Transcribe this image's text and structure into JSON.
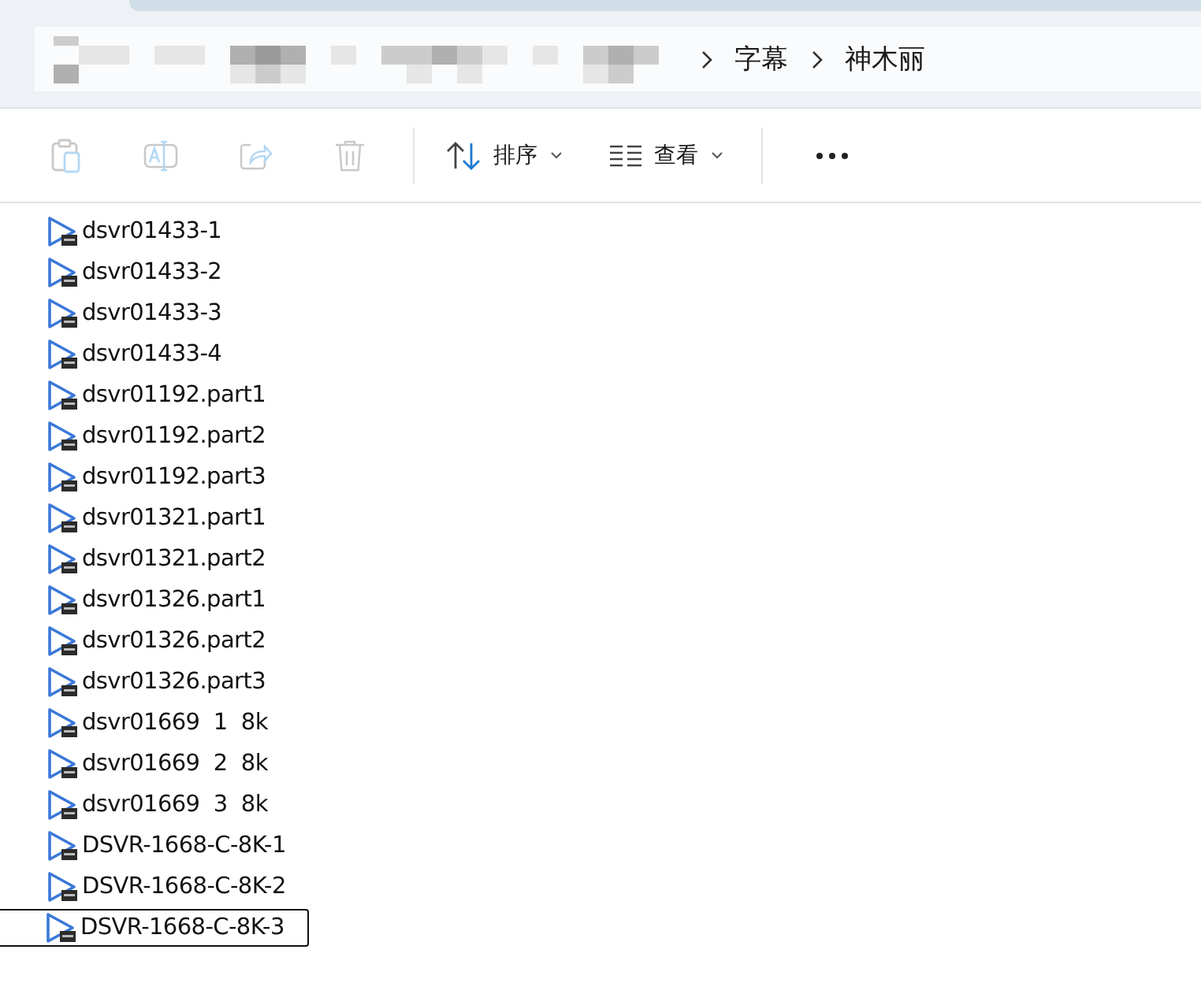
{
  "breadcrumb": {
    "segments": [
      "字幕",
      "神木丽"
    ]
  },
  "toolbar": {
    "actions": [
      {
        "kind": "paste",
        "disabled": true
      },
      {
        "kind": "rename",
        "disabled": true
      },
      {
        "kind": "share",
        "disabled": true
      },
      {
        "kind": "delete",
        "disabled": true
      }
    ],
    "menus": [
      {
        "kind": "sort",
        "label": "排序"
      },
      {
        "kind": "view",
        "label": "查看"
      }
    ]
  },
  "files": [
    {
      "name": "dsvr01433-1",
      "focused": false
    },
    {
      "name": "dsvr01433-2",
      "focused": false
    },
    {
      "name": "dsvr01433-3",
      "focused": false
    },
    {
      "name": "dsvr01433-4",
      "focused": false
    },
    {
      "name": "dsvr01192.part1",
      "focused": false
    },
    {
      "name": "dsvr01192.part2",
      "focused": false
    },
    {
      "name": "dsvr01192.part3",
      "focused": false
    },
    {
      "name": "dsvr01321.part1",
      "focused": false
    },
    {
      "name": "dsvr01321.part2",
      "focused": false
    },
    {
      "name": "dsvr01326.part1",
      "focused": false
    },
    {
      "name": "dsvr01326.part2",
      "focused": false
    },
    {
      "name": "dsvr01326.part3",
      "focused": false
    },
    {
      "name": "dsvr01669  1  8k",
      "focused": false
    },
    {
      "name": "dsvr01669  2  8k",
      "focused": false
    },
    {
      "name": "dsvr01669  3  8k",
      "focused": false
    },
    {
      "name": "DSVR-1668-C-8K-1",
      "focused": false
    },
    {
      "name": "DSVR-1668-C-8K-2",
      "focused": false
    },
    {
      "name": "DSVR-1668-C-8K-3",
      "focused": true
    }
  ]
}
